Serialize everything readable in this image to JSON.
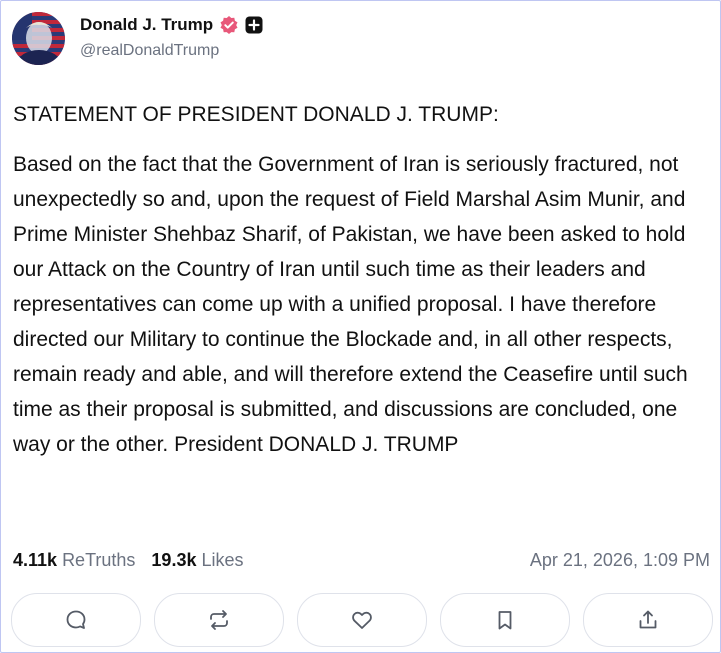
{
  "author": {
    "display_name": "Donald J. Trump",
    "handle": "@realDonaldTrump",
    "verified_color": "#e8587a"
  },
  "post": {
    "heading": "STATEMENT OF PRESIDENT DONALD J. TRUMP:",
    "body": "Based on the fact that the Government of Iran is seriously fractured, not unexpectedly so and, upon the request of Field Marshal Asim Munir, and Prime Minister Shehbaz Sharif, of Pakistan, we have been asked to hold our Attack on the Country of Iran until such time as their leaders and representatives can come up with a unified proposal. I have therefore directed our Military to continue the Blockade and, in all other respects, remain ready and able, and will therefore extend the Ceasefire until such time as their proposal is submitted, and discussions are concluded, one way or the other. President DONALD J. TRUMP"
  },
  "stats": {
    "retruths_count": "4.11k",
    "retruths_label": "ReTruths",
    "likes_count": "19.3k",
    "likes_label": "Likes",
    "timestamp": "Apr 21, 2026, 1:09 PM"
  },
  "actions": [
    {
      "icon": "reply-icon"
    },
    {
      "icon": "retruth-icon"
    },
    {
      "icon": "heart-icon"
    },
    {
      "icon": "bookmark-icon"
    },
    {
      "icon": "share-icon"
    }
  ]
}
